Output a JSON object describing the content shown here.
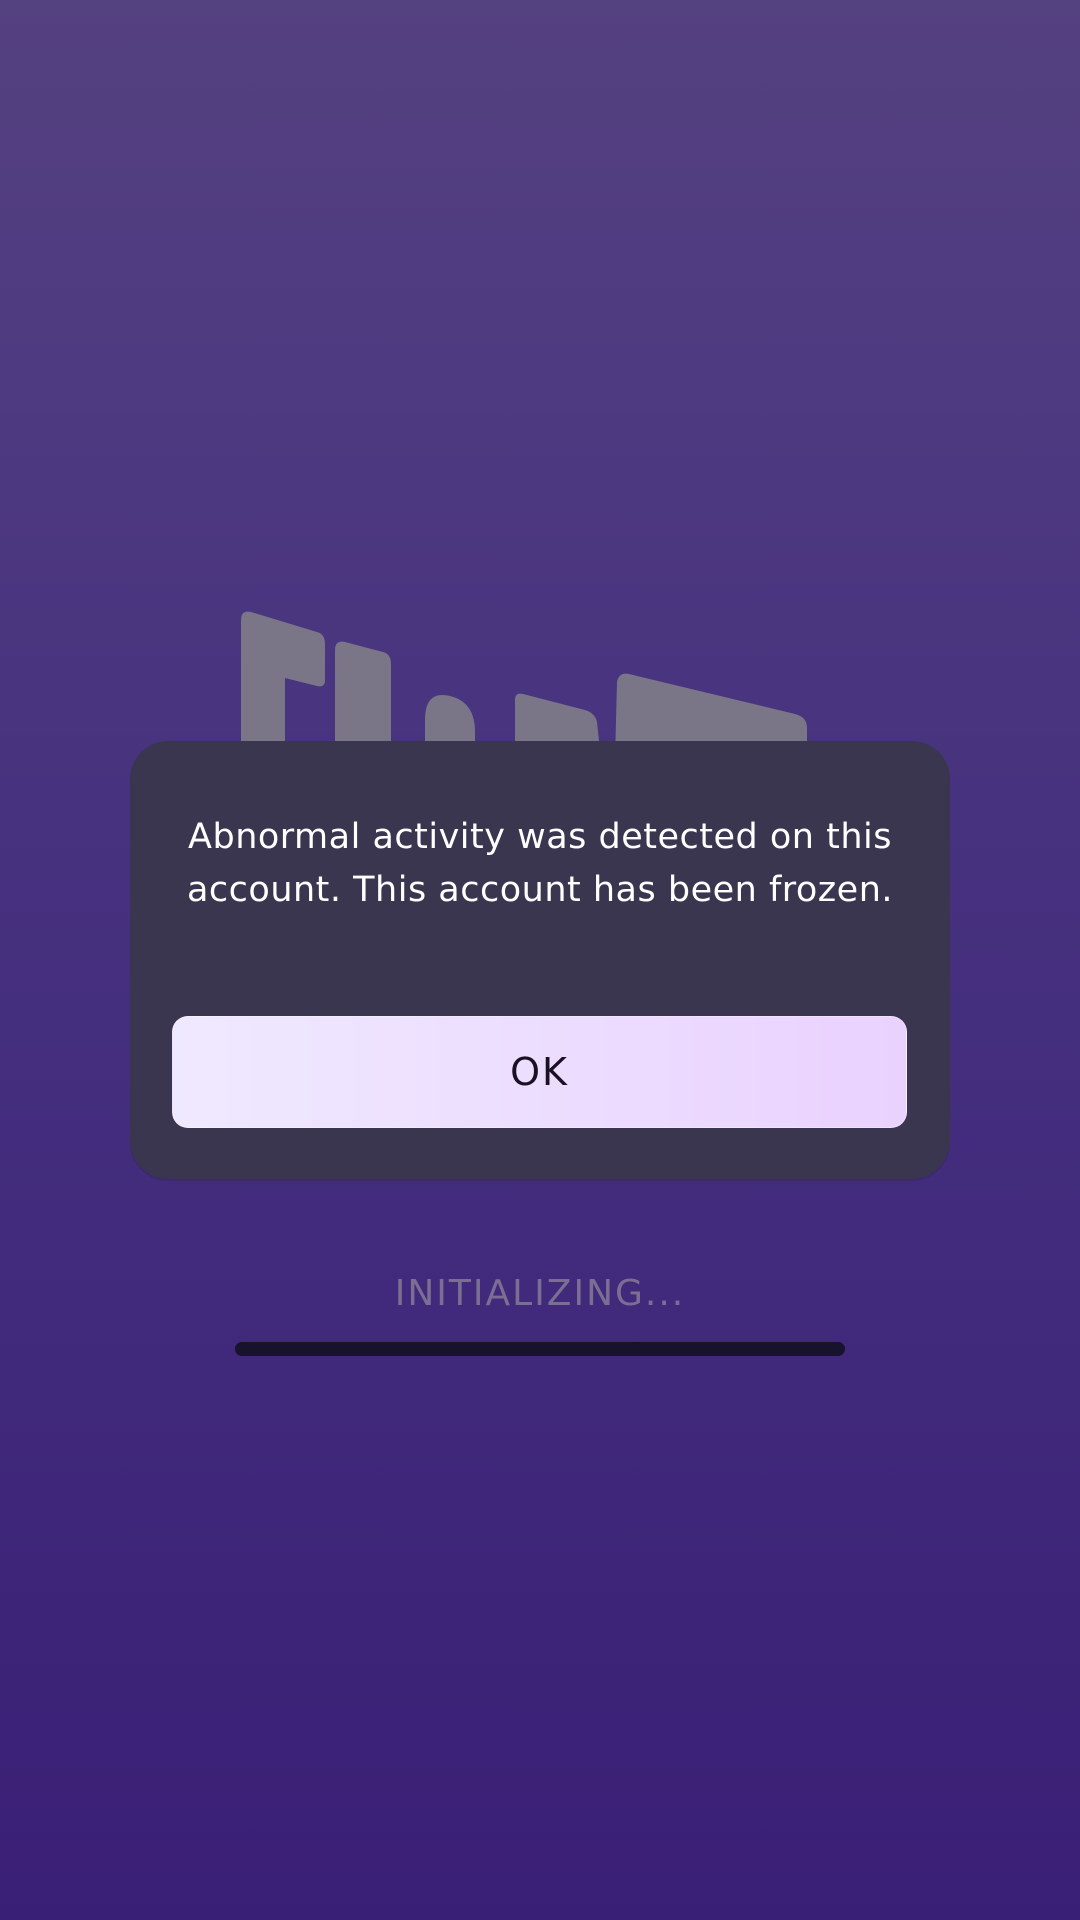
{
  "dialog": {
    "message": "Abnormal activity was detected on this account. This account has been frozen.",
    "ok_label": "OK"
  },
  "loading": {
    "status_text": "INITIALIZING...",
    "progress_percent": 0
  },
  "colors": {
    "background_top": "#544180",
    "background_bottom": "#3a1f76",
    "dialog_bg": "#3a364f",
    "button_bg_start": "#efe9ff",
    "button_bg_end": "#ead2ff",
    "logo_color": "#7a7688",
    "status_text_color": "#7a6f93",
    "progress_track": "#17132d"
  },
  "icons": {
    "background_logo": "app-logo-icon"
  }
}
